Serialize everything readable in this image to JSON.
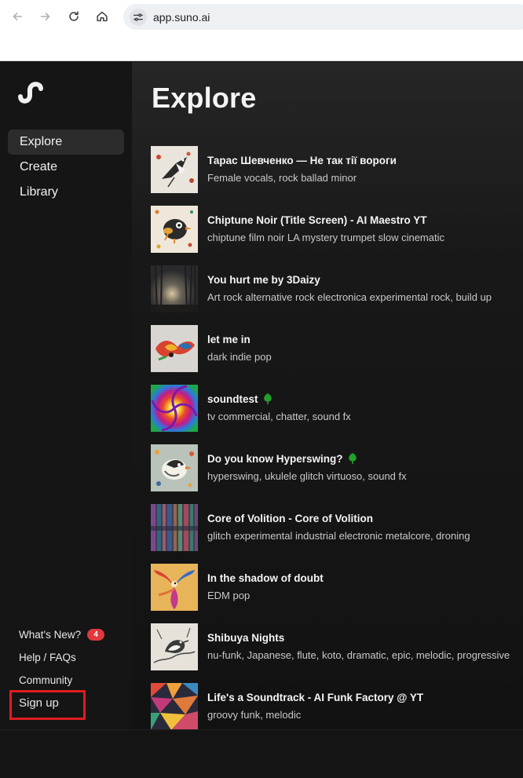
{
  "browser": {
    "url": "app.suno.ai",
    "icons": [
      "back-arrow-icon",
      "forward-arrow-icon",
      "reload-icon",
      "home-icon",
      "site-info-icon"
    ]
  },
  "sidebar": {
    "logo": "suno-logo-icon",
    "nav": [
      {
        "label": "Explore",
        "active": true
      },
      {
        "label": "Create",
        "active": false
      },
      {
        "label": "Library",
        "active": false
      }
    ],
    "bottom": {
      "whats_new": "What's New?",
      "whats_new_badge": "4",
      "help": "Help / FAQs",
      "community": "Community",
      "signup": "Sign up"
    }
  },
  "main": {
    "title": "Explore",
    "songs": [
      {
        "title": "Тарас Шевченко — Не так тії вороги",
        "tags": "Female vocals, rock ballad minor"
      },
      {
        "title": "Chiptune Noir (Title Screen) - AI Maestro YT",
        "tags": "chiptune film noir LA mystery trumpet slow cinematic"
      },
      {
        "title": "You hurt me by 3Daizy",
        "tags": "Art rock alternative rock electronica experimental rock, build up"
      },
      {
        "title": "let me in",
        "tags": "dark indie pop"
      },
      {
        "title": "soundtest",
        "tags": "tv commercial, chatter, sound fx"
      },
      {
        "title": "Do you know Hyperswing?",
        "tags": "hyperswing, ukulele glitch virtuoso, sound fx"
      },
      {
        "title": "Core of Volition - Core of Volition",
        "tags": "glitch experimental industrial electronic metalcore, droning"
      },
      {
        "title": "In the shadow of doubt",
        "tags": "EDM pop"
      },
      {
        "title": "Shibuya Nights",
        "tags": "nu-funk, Japanese, flute, koto, dramatic, epic, melodic, progressive"
      },
      {
        "title": "Life's a Soundtrack - AI Funk Factory @ YT",
        "tags": "groovy funk, melodic"
      }
    ]
  },
  "colors": {
    "accent_red": "#e11b22",
    "badge_red": "#e0383e",
    "tree_green": "#22a02a"
  }
}
